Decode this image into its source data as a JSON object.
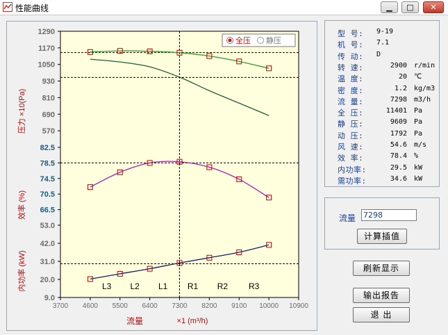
{
  "window": {
    "title": "性能曲线"
  },
  "params": [
    {
      "label": "型  号:",
      "value": "9-19",
      "unit": "",
      "align": "left"
    },
    {
      "label": "机  号:",
      "value": "7.1",
      "unit": "",
      "align": "left"
    },
    {
      "label": "传  动:",
      "value": "D",
      "unit": "",
      "align": "left"
    },
    {
      "label": "转  速:",
      "value": "2900",
      "unit": "r/min"
    },
    {
      "label": "温  度:",
      "value": "20",
      "unit": "℃"
    },
    {
      "label": "密  度:",
      "value": "1.2",
      "unit": "kg/m3"
    },
    {
      "label": "流  量:",
      "value": "7298",
      "unit": "m3/h"
    },
    {
      "label": "全  压:",
      "value": "11401",
      "unit": "Pa"
    },
    {
      "label": "静  压:",
      "value": "9609",
      "unit": "Pa"
    },
    {
      "label": "动  压:",
      "value": "1792",
      "unit": "Pa"
    },
    {
      "label": "风  速:",
      "value": "54.6",
      "unit": "m/s"
    },
    {
      "label": "效  率:",
      "value": "78.4",
      "unit": "%"
    },
    {
      "label": "内功率:",
      "value": "29.5",
      "unit": "kW"
    },
    {
      "label": "需功率:",
      "value": "34.6",
      "unit": "kW"
    }
  ],
  "interp": {
    "label": "流量",
    "value": "7298",
    "button": "计算插值"
  },
  "buttons": {
    "refresh": "刷新显示",
    "report": "输出报告",
    "exit": "退  出"
  },
  "chart_data": {
    "type": "line",
    "x_ticks": [
      "3700",
      "4600",
      "5500",
      "6400",
      "7300",
      "8200",
      "9100",
      "10000",
      "10900"
    ],
    "xlabel": "流量",
    "xunit": "×1 (m³/h)",
    "xlim": [
      3700,
      10900
    ],
    "operating_flow": 7298,
    "legend": [
      "全压",
      "静压"
    ],
    "regions": [
      "L3",
      "L2",
      "L1",
      "R1",
      "R2",
      "R3"
    ],
    "pressure": {
      "ylabel": "压力 ×10(Pa)",
      "ylim": [
        450,
        1290
      ],
      "ticks": [
        "1290",
        "1170",
        "1050",
        "930",
        "810",
        "690",
        "570"
      ],
      "total_pressure_x": [
        4600,
        5500,
        6400,
        7300,
        8200,
        9100,
        10000
      ],
      "total_pressure": [
        1140,
        1148,
        1145,
        1135,
        1111,
        1072,
        1022
      ],
      "static_pressure_x": [
        4600,
        5500,
        6400,
        7300,
        8200,
        9100,
        10000
      ],
      "static_pressure": [
        1088,
        1068,
        1033,
        958,
        860,
        770,
        680
      ],
      "guide_levels": [
        1136,
        956
      ]
    },
    "efficiency": {
      "ylabel": "效率 (%)",
      "ylim": [
        62.5,
        82.5
      ],
      "ticks": [
        "82.5",
        "78.5",
        "74.5",
        "70.5",
        "66.5"
      ],
      "x": [
        4600,
        5500,
        6400,
        7300,
        8200,
        9100,
        10000
      ],
      "values": [
        72.3,
        76.1,
        78.5,
        78.8,
        77.4,
        74.3,
        69.6
      ],
      "guide_level": 78.5
    },
    "power": {
      "ylabel": "内功率 (kW)",
      "ylim": [
        9,
        53
      ],
      "ticks": [
        "53.0",
        "42.0",
        "31.0",
        "20.0",
        "9.0"
      ],
      "x": [
        4600,
        5500,
        6400,
        7300,
        8200,
        9100,
        10000
      ],
      "values": [
        20.2,
        23.4,
        26.5,
        30.0,
        33.2,
        36.5,
        41.0
      ],
      "guide_level": 29.5
    }
  }
}
